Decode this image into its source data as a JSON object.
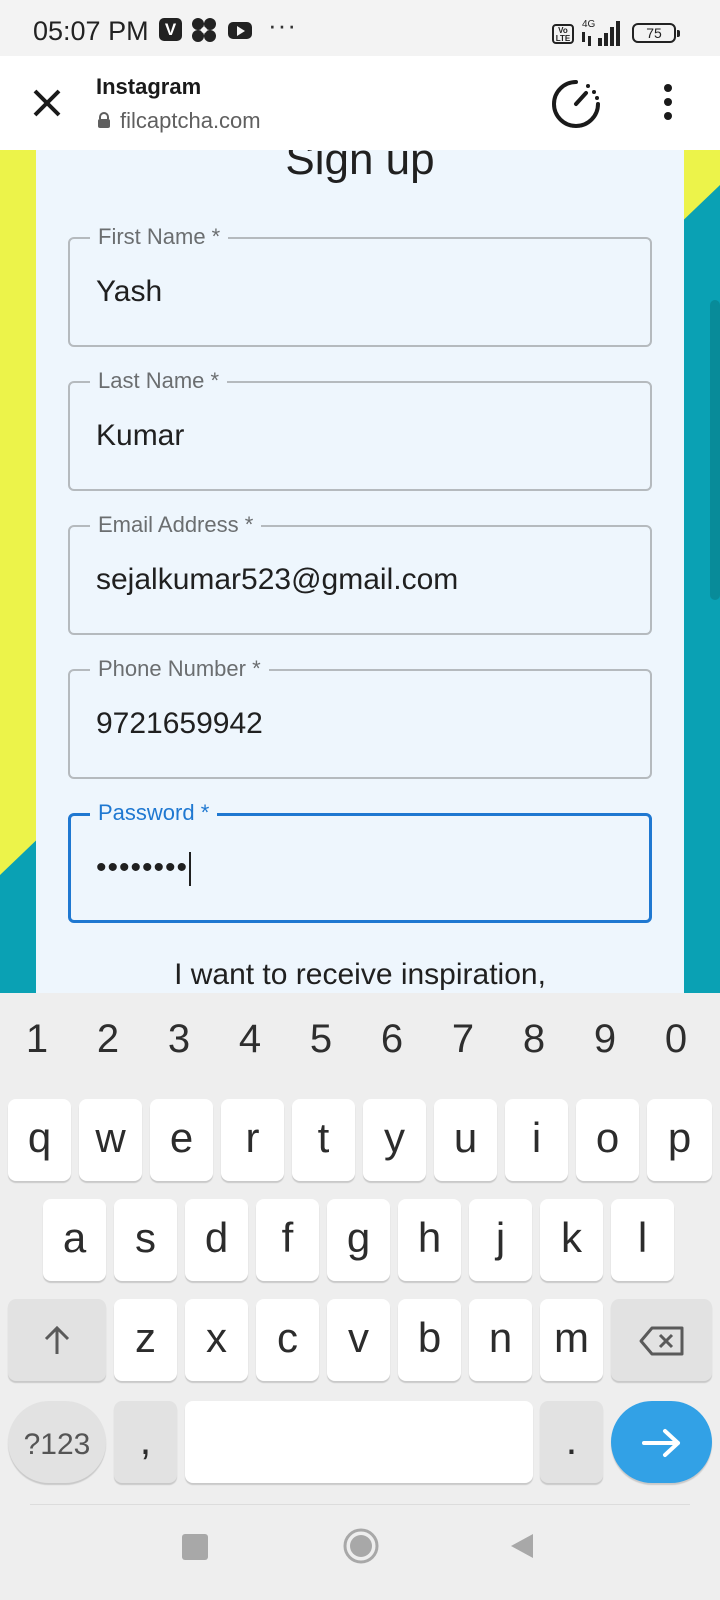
{
  "status_bar": {
    "time": "05:07 PM",
    "app_icon_letter": "V",
    "more": "···",
    "network": "4G",
    "volte": "Vo LTE",
    "battery": "75"
  },
  "browser": {
    "title": "Instagram",
    "url": "filcaptcha.com"
  },
  "form": {
    "title": "Sign up",
    "fields": [
      {
        "label": "First Name *",
        "value": "Yash"
      },
      {
        "label": "Last Name *",
        "value": "Kumar"
      },
      {
        "label": "Email Address *",
        "value": "sejalkumar523@gmail.com"
      },
      {
        "label": "Phone Number *",
        "value": "9721659942"
      },
      {
        "label": "Password *",
        "value": "••••••••"
      }
    ],
    "inspiration_text": "I want to receive inspiration,"
  },
  "keyboard": {
    "numbers": [
      "1",
      "2",
      "3",
      "4",
      "5",
      "6",
      "7",
      "8",
      "9",
      "0"
    ],
    "row1": [
      "q",
      "w",
      "e",
      "r",
      "t",
      "y",
      "u",
      "i",
      "o",
      "p"
    ],
    "row2": [
      "a",
      "s",
      "d",
      "f",
      "g",
      "h",
      "j",
      "k",
      "l"
    ],
    "row3": [
      "z",
      "x",
      "c",
      "v",
      "b",
      "n",
      "m"
    ],
    "symbols_key": "?123",
    "comma_key": ",",
    "period_key": "."
  },
  "colors": {
    "accent": "#1f78d1",
    "enter_key": "#32a1e6",
    "page_yellow": "#ecf34a",
    "page_teal": "#0aa1b4"
  }
}
